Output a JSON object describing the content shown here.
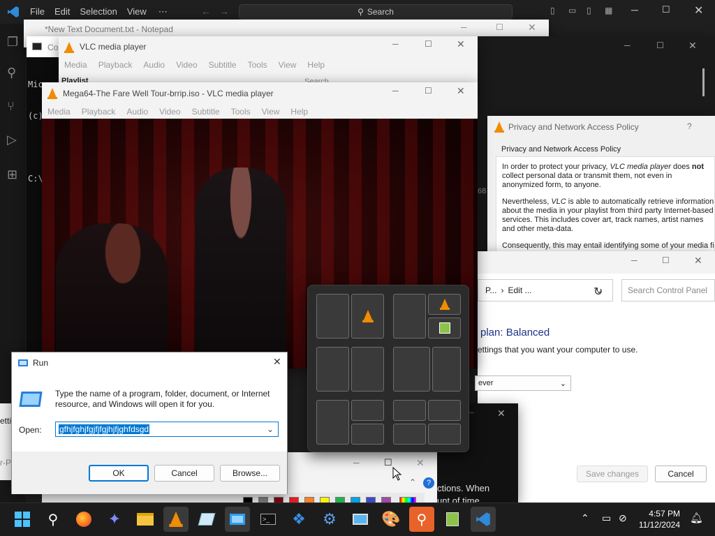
{
  "vscode": {
    "menu": [
      "File",
      "Edit",
      "Selection",
      "View",
      "⋯"
    ],
    "search_placeholder": "Search"
  },
  "notepad": {
    "title": "*New Text Document.txt - Notepad"
  },
  "cmd": {
    "title_short": "Co",
    "lines": [
      "Micros",
      "(c) Mi",
      "",
      "C:\\"
    ]
  },
  "vlc_back": {
    "title": "VLC media player",
    "menu": [
      "Media",
      "Playback",
      "Audio",
      "Video",
      "Subtitle",
      "Tools",
      "View",
      "Help"
    ],
    "playlist": "Playlist",
    "search": "Search"
  },
  "vlc_front": {
    "title": "Mega64-The Fare Well Tour-brrip.iso - VLC media player",
    "menu": [
      "Media",
      "Playback",
      "Audio",
      "Video",
      "Subtitle",
      "Tools",
      "View",
      "Help"
    ]
  },
  "privacy": {
    "title": "Privacy and Network Access Policy",
    "help": "?",
    "heading": "Privacy and Network Access Policy",
    "p1_a": "In order to protect your privacy, ",
    "p1_b": "VLC media player",
    "p1_c": " does ",
    "p1_d": "not",
    "p1_e": " collect personal data or transmit them, not even in anonymized form, to anyone.",
    "p2_a": "Nevertheless, ",
    "p2_b": "VLC",
    "p2_c": " is able to automatically retrieve information about the media in your playlist from third party Internet-based services. This includes cover art, track names, artist names and other meta-data.",
    "p3": "Consequently, this may entail identifying some of your media fil",
    "side_number": "68"
  },
  "control_panel": {
    "breadcrumb_1": "P...",
    "breadcrumb_sep": "›",
    "breadcrumb_2": "Edit ...",
    "search_placeholder": "Search Control Panel",
    "plan_title": "plan: Balanced",
    "plan_desc": "ettings that you want your computer to use.",
    "dropdown_value": "ever",
    "save_label": "Save changes",
    "cancel_label": "Cancel"
  },
  "run": {
    "title": "Run",
    "description": "Type the name of a program, folder, document, or Internet resource, and Windows will open it for you.",
    "open_label": "Open:",
    "input_value": "gfhjfghjfgjfjfgjhjfjghfdsgd",
    "ok_label": "OK",
    "cancel_label": "Cancel",
    "browse_label": "Browse..."
  },
  "paint": {
    "partial_1": "ctions. When",
    "partial_2": "unt of time",
    "side_1": "etti",
    "side_2": "r-Pa"
  },
  "snap_layout": {
    "layouts": 6
  },
  "taskbar": {
    "time": "4:57 PM",
    "date": "11/12/2024",
    "apps": [
      "start-icon",
      "search-icon",
      "firefox-icon",
      "bird-app-icon",
      "file-explorer-icon",
      "vlc-icon",
      "notepad-doc-icon",
      "run-dialog-icon",
      "terminal-icon",
      "network-app-icon",
      "settings-gear-icon",
      "remote-desktop-icon",
      "paint-icon",
      "magnifier-icon",
      "notepad-plus-icon",
      "vscode-icon"
    ]
  },
  "colors": {
    "vscode_bg": "#1f1f1f",
    "taskbar_bg": "#1c1c1c",
    "accent": "#0067c0",
    "vlc_orange": "#f08c00",
    "selection": "#0078d4"
  }
}
